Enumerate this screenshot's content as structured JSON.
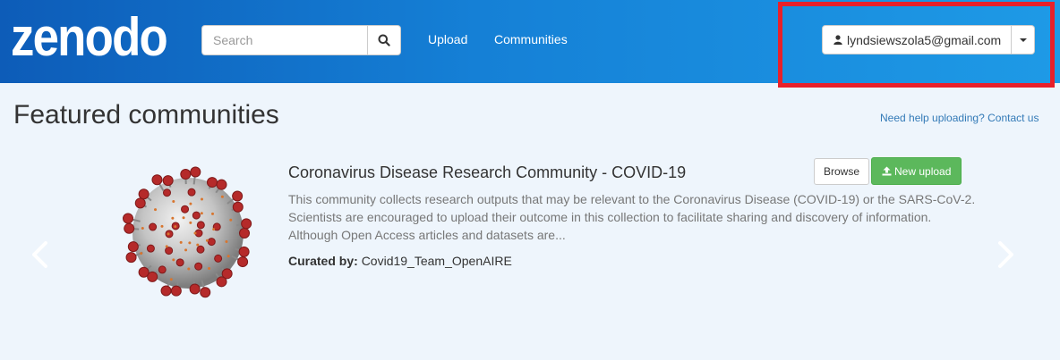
{
  "header": {
    "logo_text": "zenodo",
    "search_placeholder": "Search",
    "nav": {
      "upload": "Upload",
      "communities": "Communities"
    },
    "user_email": "lyndsiewszola5@gmail.com"
  },
  "main": {
    "title": "Featured communities",
    "help_link": "Need help uploading? Contact us",
    "community": {
      "title": "Coronavirus Disease Research Community - COVID-19",
      "description": "This community collects research outputs that may be relevant to the Coronavirus Disease (COVID-19) or the SARS-CoV-2. Scientists are encouraged to upload their outcome in this collection to facilitate sharing and discovery of information. Although Open Access articles and datasets are...",
      "curated_label": "Curated by:",
      "curator": "Covid19_Team_OpenAIRE",
      "browse_label": "Browse",
      "new_upload_label": "New upload"
    }
  },
  "colors": {
    "navbar_start": "#0d5cb8",
    "navbar_end": "#1e9ae6",
    "highlight": "#e8202a",
    "success": "#5cb85c",
    "link": "#337ab7"
  },
  "icons": [
    "search-icon",
    "user-icon",
    "caret-down-icon",
    "upload-icon",
    "chevron-left-icon",
    "chevron-right-icon"
  ]
}
